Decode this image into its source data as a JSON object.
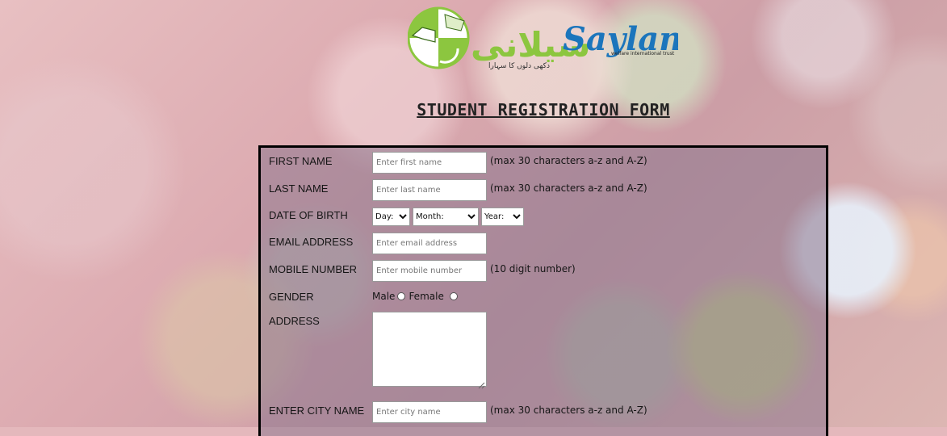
{
  "logo": {
    "urdu_text": "سیلانی",
    "brand_text": "Saylani",
    "tagline": "welfare international trust",
    "urdu_slogan": "دکھی دلوں کا سہارا",
    "colors": {
      "green": "#8cc63f",
      "blue": "#1b75bc"
    }
  },
  "page": {
    "title": "STUDENT REGISTRATION FORM"
  },
  "form": {
    "first_name": {
      "label": "FIRST NAME",
      "placeholder": "Enter first name",
      "hint": "(max 30 characters a-z and A-Z)"
    },
    "last_name": {
      "label": "LAST NAME",
      "placeholder": "Enter last name",
      "hint": "(max 30 characters a-z and A-Z)"
    },
    "dob": {
      "label": "DATE OF BIRTH",
      "day": "Day:",
      "month": "Month:",
      "year": "Year:"
    },
    "email": {
      "label": "EMAIL ADDRESS",
      "placeholder": "Enter email address"
    },
    "mobile": {
      "label": "MOBILE NUMBER",
      "placeholder": "Enter mobile number",
      "hint": "(10 digit number)"
    },
    "gender": {
      "label": "GENDER",
      "male": "Male",
      "female": "Female"
    },
    "address": {
      "label": "ADDRESS"
    },
    "city": {
      "label": "ENTER CITY NAME",
      "placeholder": "Enter city name",
      "hint": "(max 30 characters a-z and A-Z)"
    }
  }
}
